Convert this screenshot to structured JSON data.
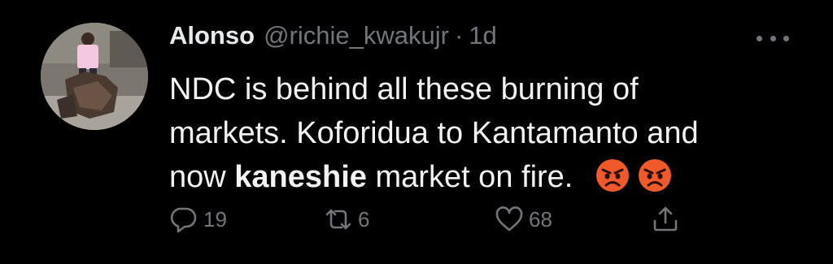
{
  "tweet": {
    "display_name": "Alonso",
    "handle": "@richie_kwakujr",
    "separator": "·",
    "time": "1d",
    "text": {
      "line1": "NDC is behind all these burning of",
      "line2": "markets. Koforidua to Kantamanto and",
      "line3_before": "now ",
      "line3_bold": "kaneshie",
      "line3_after": " market on fire."
    },
    "emojis": [
      "angry-face-icon",
      "angry-face-icon"
    ],
    "more_icon": "more-horizontal-icon"
  },
  "actions": {
    "reply": {
      "icon": "reply-icon",
      "count": "19"
    },
    "retweet": {
      "icon": "retweet-icon",
      "count": "6"
    },
    "like": {
      "icon": "heart-icon",
      "count": "68"
    },
    "share": {
      "icon": "share-icon"
    }
  },
  "colors": {
    "background": "#000000",
    "primary_text": "#e7e9ea",
    "secondary_text": "#71767b",
    "emoji_face": "#f05a2a"
  }
}
